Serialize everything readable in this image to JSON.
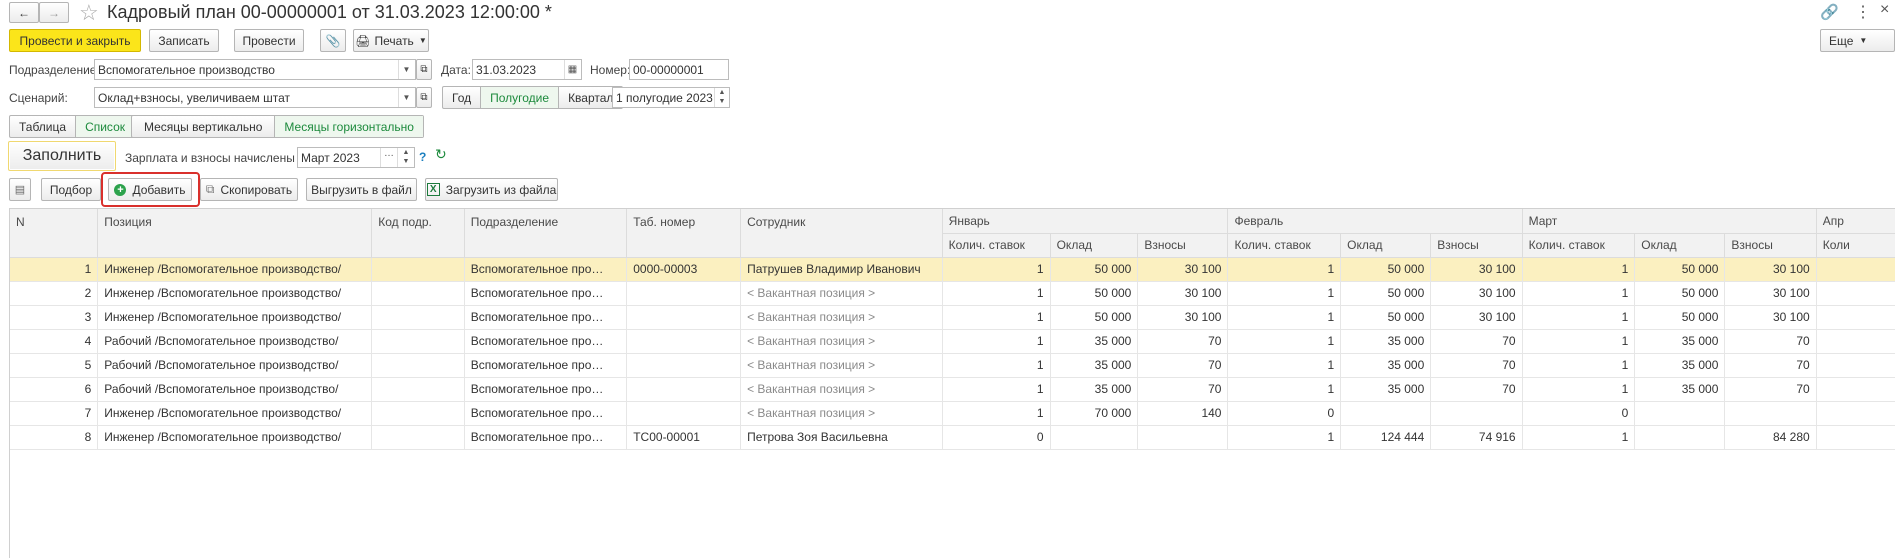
{
  "title": "Кадровый план 00-00000001 от 31.03.2023 12:00:00 *",
  "toolbar": {
    "post_close": "Провести и закрыть",
    "save": "Записать",
    "post": "Провести",
    "print": "Печать",
    "more": "Еще"
  },
  "form": {
    "dept_label": "Подразделение:",
    "dept_value": "Вспомогательное производство",
    "date_label": "Дата:",
    "date_value": "31.03.2023",
    "num_label": "Номер:",
    "num_value": "00-00000001",
    "scenario_label": "Сценарий:",
    "scenario_value": "Оклад+взносы, увеличиваем штат",
    "period_year": "Год",
    "period_half": "Полугодие",
    "period_quarter": "Квартал",
    "period_value": "1 полугодие 2023",
    "view_table": "Таблица",
    "view_list": "Список",
    "months_vert": "Месяцы вертикально",
    "months_horiz": "Месяцы горизонтально",
    "fill": "Заполнить",
    "salary_label": "Зарплата и взносы начислены по:",
    "salary_value": "Март 2023",
    "help": "?"
  },
  "cmd": {
    "pick": "Подбор",
    "add": "Добавить",
    "copy": "Скопировать",
    "export": "Выгрузить в файл",
    "import": "Загрузить из файла"
  },
  "table": {
    "headers": {
      "n": "N",
      "position": "Позиция",
      "code": "Код подр.",
      "dept": "Подразделение",
      "tab": "Таб. номер",
      "employee": "Сотрудник",
      "jan": "Январь",
      "feb": "Февраль",
      "mar": "Март",
      "apr": "Апр",
      "qty": "Колич. ставок",
      "salary": "Оклад",
      "contrib": "Взносы",
      "qty_cut": "Коли"
    },
    "rows": [
      {
        "n": "1",
        "position": "Инженер /Вспомогательное производство/",
        "code": "",
        "dept": "Вспомогательное про…",
        "tab": "0000-00003",
        "employee": "Патрушев Владимир Иванович",
        "j1": "1",
        "j2": "50 000",
        "j3": "30 100",
        "f1": "1",
        "f2": "50 000",
        "f3": "30 100",
        "m1": "1",
        "m2": "50 000",
        "m3": "30 100"
      },
      {
        "n": "2",
        "position": "Инженер /Вспомогательное производство/",
        "code": "",
        "dept": "Вспомогательное про…",
        "tab": "",
        "employee": "< Вакантная позиция >",
        "j1": "1",
        "j2": "50 000",
        "j3": "30 100",
        "f1": "1",
        "f2": "50 000",
        "f3": "30 100",
        "m1": "1",
        "m2": "50 000",
        "m3": "30 100"
      },
      {
        "n": "3",
        "position": "Инженер /Вспомогательное производство/",
        "code": "",
        "dept": "Вспомогательное про…",
        "tab": "",
        "employee": "< Вакантная позиция >",
        "j1": "1",
        "j2": "50 000",
        "j3": "30 100",
        "f1": "1",
        "f2": "50 000",
        "f3": "30 100",
        "m1": "1",
        "m2": "50 000",
        "m3": "30 100"
      },
      {
        "n": "4",
        "position": "Рабочий /Вспомогательное производство/",
        "code": "",
        "dept": "Вспомогательное про…",
        "tab": "",
        "employee": "< Вакантная позиция >",
        "j1": "1",
        "j2": "35 000",
        "j3": "70",
        "f1": "1",
        "f2": "35 000",
        "f3": "70",
        "m1": "1",
        "m2": "35 000",
        "m3": "70"
      },
      {
        "n": "5",
        "position": "Рабочий /Вспомогательное производство/",
        "code": "",
        "dept": "Вспомогательное про…",
        "tab": "",
        "employee": "< Вакантная позиция >",
        "j1": "1",
        "j2": "35 000",
        "j3": "70",
        "f1": "1",
        "f2": "35 000",
        "f3": "70",
        "m1": "1",
        "m2": "35 000",
        "m3": "70"
      },
      {
        "n": "6",
        "position": "Рабочий /Вспомогательное производство/",
        "code": "",
        "dept": "Вспомогательное про…",
        "tab": "",
        "employee": "< Вакантная позиция >",
        "j1": "1",
        "j2": "35 000",
        "j3": "70",
        "f1": "1",
        "f2": "35 000",
        "f3": "70",
        "m1": "1",
        "m2": "35 000",
        "m3": "70"
      },
      {
        "n": "7",
        "position": "Инженер /Вспомогательное производство/",
        "code": "",
        "dept": "Вспомогательное про…",
        "tab": "",
        "employee": "< Вакантная позиция >",
        "j1": "1",
        "j2": "70 000",
        "j3": "140",
        "f1": "0",
        "f2": "",
        "f3": "",
        "m1": "0",
        "m2": "",
        "m3": ""
      },
      {
        "n": "8",
        "position": "Инженер /Вспомогательное производство/",
        "code": "",
        "dept": "Вспомогательное про…",
        "tab": "ТС00-00001",
        "employee": "Петрова Зоя Васильевна",
        "j1": "0",
        "j2": "",
        "j3": "",
        "f1": "1",
        "f2": "124 444",
        "f3": "74 916",
        "m1": "1",
        "m2": "",
        "m3": "84 280"
      }
    ]
  },
  "colors": {
    "accent": "#fbe51a",
    "highlight": "#d9302c",
    "selected_row": "#fbf0c0",
    "green": "#1c8a3c"
  }
}
